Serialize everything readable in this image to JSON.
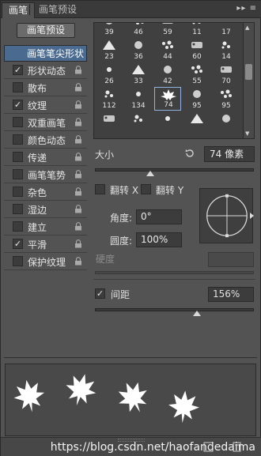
{
  "tabs": [
    {
      "label": "画笔",
      "active": true
    },
    {
      "label": "画笔预设",
      "active": false
    }
  ],
  "tab_menu_icon": "flyout-menu-icon",
  "left": {
    "preset_button": "画笔预设",
    "tip_shape": "画笔笔尖形状",
    "options": [
      {
        "label": "形状动态",
        "checked": true
      },
      {
        "label": "散布",
        "checked": false
      },
      {
        "label": "纹理",
        "checked": true
      },
      {
        "label": "双重画笔",
        "checked": false
      },
      {
        "label": "颜色动态",
        "checked": false
      },
      {
        "label": "传递",
        "checked": false
      },
      {
        "label": "画笔笔势",
        "checked": false
      },
      {
        "label": "杂色",
        "checked": false
      },
      {
        "label": "湿边",
        "checked": false
      },
      {
        "label": "建立",
        "checked": false
      },
      {
        "label": "平滑",
        "checked": true
      },
      {
        "label": "保护纹理",
        "checked": false
      }
    ],
    "check_glyph": "✓"
  },
  "brushes": [
    {
      "num": "39"
    },
    {
      "num": "46"
    },
    {
      "num": "59"
    },
    {
      "num": "11"
    },
    {
      "num": "17"
    },
    {
      "num": "23"
    },
    {
      "num": "36"
    },
    {
      "num": "44"
    },
    {
      "num": "60"
    },
    {
      "num": "14"
    },
    {
      "num": "26"
    },
    {
      "num": "33"
    },
    {
      "num": "42"
    },
    {
      "num": "55"
    },
    {
      "num": "70"
    },
    {
      "num": "112"
    },
    {
      "num": "134"
    },
    {
      "num": "74",
      "selected": true
    },
    {
      "num": "95"
    },
    {
      "num": "95"
    },
    {
      "num": ""
    },
    {
      "num": ""
    },
    {
      "num": ""
    },
    {
      "num": ""
    },
    {
      "num": ""
    }
  ],
  "size": {
    "label": "大小",
    "value": "74 像素",
    "reset_icon": "reset-icon",
    "slider_pct": 35
  },
  "flip_x": {
    "label": "翻转 X",
    "checked": false
  },
  "flip_y": {
    "label": "翻转 Y",
    "checked": false
  },
  "angle": {
    "label": "角度:",
    "value": "0°"
  },
  "roundness": {
    "label": "圆度:",
    "value": "100%"
  },
  "hardness": {
    "label": "硬度"
  },
  "spacing": {
    "label": "间距",
    "checked": true,
    "value": "156%",
    "slider_pct": 64
  },
  "watermark": "https://blog.csdn.net/haofandedaima",
  "colors": {
    "panel": "#535353",
    "accent": "#4a6a8f",
    "field": "#3c3c3c"
  }
}
